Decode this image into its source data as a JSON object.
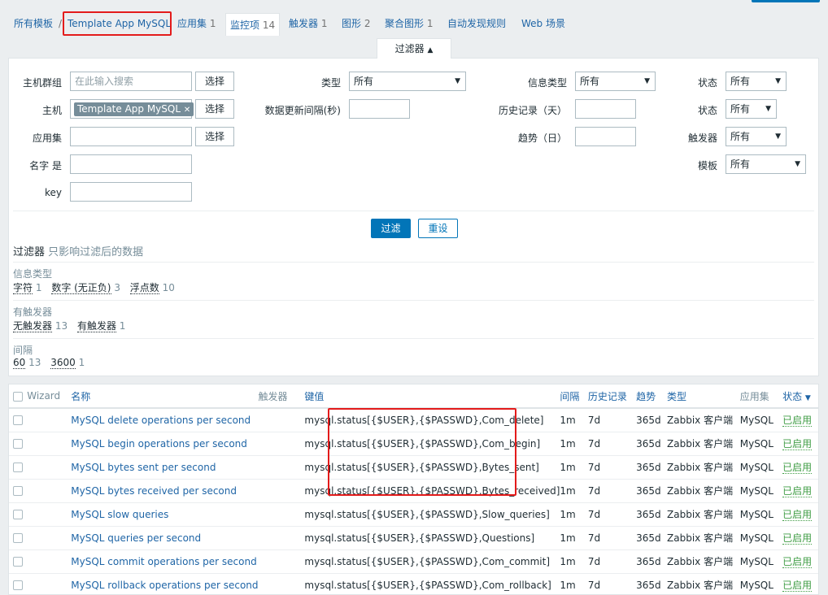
{
  "nav": {
    "all_templates": "所有模板",
    "separator": "/",
    "template_name": "Template App MySQL",
    "tabs": [
      {
        "label": "应用集",
        "count": "1"
      },
      {
        "label": "监控项",
        "count": "14"
      },
      {
        "label": "触发器",
        "count": "1"
      },
      {
        "label": "图形",
        "count": "2"
      },
      {
        "label": "聚合图形",
        "count": "1"
      },
      {
        "label": "自动发现规则",
        "count": ""
      },
      {
        "label": "Web 场景",
        "count": ""
      }
    ]
  },
  "filter_tab": {
    "label": "过滤器",
    "arrow": "▲"
  },
  "filter": {
    "host_group_label": "主机群组",
    "host_group_placeholder": "在此输入搜索",
    "select_label": "选择",
    "host_label": "主机",
    "host_tag": "Template App MySQL",
    "host_tag_remove": "✕",
    "app_label": "应用集",
    "name_label": "名字 是",
    "key_label": "key",
    "type_label": "类型",
    "type_value": "所有",
    "interval_label": "数据更新间隔(秒)",
    "info_type_label": "信息类型",
    "info_type_value": "所有",
    "history_label": "历史记录（天）",
    "trends_label": "趋势（日）",
    "state_label": "状态",
    "state_value": "所有",
    "status_label": "状态",
    "status_value": "所有",
    "triggers_label": "触发器",
    "triggers_value": "所有",
    "template_label": "模板",
    "template_value": "所有",
    "apply_button": "过滤",
    "reset_button": "重设",
    "arrow": "▼"
  },
  "subfilter": {
    "title": "过滤器",
    "note": "只影响过滤后的数据",
    "groups": [
      {
        "title": "信息类型",
        "items": [
          {
            "label": "字符",
            "count": "1"
          },
          {
            "label": "数字 (无正负)",
            "count": "3"
          },
          {
            "label": "浮点数",
            "count": "10"
          }
        ]
      },
      {
        "title": "有触发器",
        "items": [
          {
            "label": "无触发器",
            "count": "13"
          },
          {
            "label": "有触发器",
            "count": "1"
          }
        ]
      },
      {
        "title": "间隔",
        "items": [
          {
            "label": "60",
            "count": "13"
          },
          {
            "label": "3600",
            "count": "1"
          }
        ]
      }
    ]
  },
  "table": {
    "headers": {
      "wizard": "Wizard",
      "name": "名称",
      "triggers": "触发器",
      "key": "键值",
      "interval": "间隔",
      "history": "历史记录",
      "trends": "趋势",
      "type": "类型",
      "applications": "应用集",
      "status": "状态",
      "status_arrow": "▼"
    },
    "rows": [
      {
        "name": "MySQL delete operations per second",
        "key": "mysql.status[{$USER},{$PASSWD},Com_delete]",
        "interval": "1m",
        "history": "7d",
        "trends": "365d",
        "type": "Zabbix 客户端",
        "app": "MySQL",
        "status": "已启用"
      },
      {
        "name": "MySQL begin operations per second",
        "key": "mysql.status[{$USER},{$PASSWD},Com_begin]",
        "interval": "1m",
        "history": "7d",
        "trends": "365d",
        "type": "Zabbix 客户端",
        "app": "MySQL",
        "status": "已启用"
      },
      {
        "name": "MySQL bytes sent per second",
        "key": "mysql.status[{$USER},{$PASSWD},Bytes_sent]",
        "interval": "1m",
        "history": "7d",
        "trends": "365d",
        "type": "Zabbix 客户端",
        "app": "MySQL",
        "status": "已启用"
      },
      {
        "name": "MySQL bytes received per second",
        "key": "mysql.status[{$USER},{$PASSWD},Bytes_received]",
        "interval": "1m",
        "history": "7d",
        "trends": "365d",
        "type": "Zabbix 客户端",
        "app": "MySQL",
        "status": "已启用"
      },
      {
        "name": "MySQL slow queries",
        "key": "mysql.status[{$USER},{$PASSWD},Slow_queries]",
        "interval": "1m",
        "history": "7d",
        "trends": "365d",
        "type": "Zabbix 客户端",
        "app": "MySQL",
        "status": "已启用"
      },
      {
        "name": "MySQL queries per second",
        "key": "mysql.status[{$USER},{$PASSWD},Questions]",
        "interval": "1m",
        "history": "7d",
        "trends": "365d",
        "type": "Zabbix 客户端",
        "app": "MySQL",
        "status": "已启用"
      },
      {
        "name": "MySQL commit operations per second",
        "key": "mysql.status[{$USER},{$PASSWD},Com_commit]",
        "interval": "1m",
        "history": "7d",
        "trends": "365d",
        "type": "Zabbix 客户端",
        "app": "MySQL",
        "status": "已启用"
      },
      {
        "name": "MySQL rollback operations per second",
        "key": "mysql.status[{$USER},{$PASSWD},Com_rollback]",
        "interval": "1m",
        "history": "7d",
        "trends": "365d",
        "type": "Zabbix 客户端",
        "app": "MySQL",
        "status": "已启用"
      }
    ]
  }
}
